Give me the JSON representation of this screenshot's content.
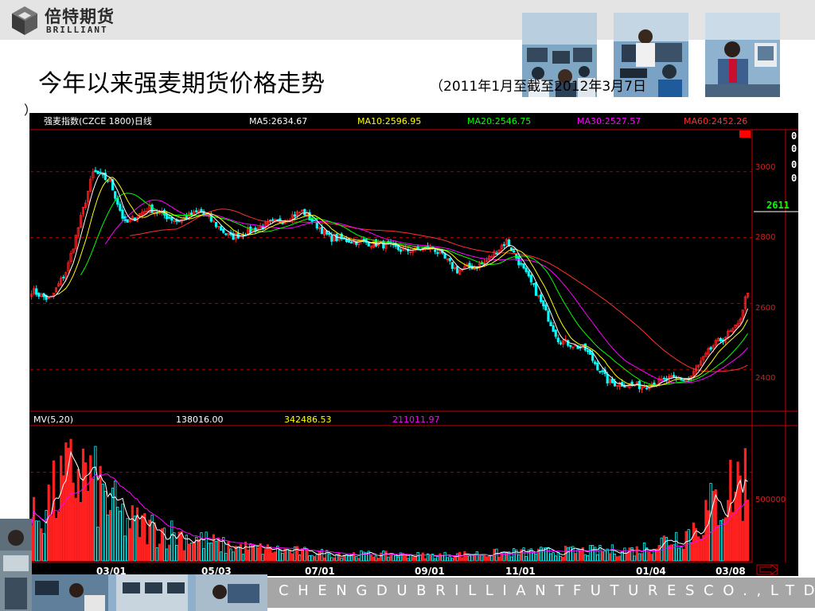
{
  "logo": {
    "name_cn": "倍特期货",
    "name_en": "BRILLIANT"
  },
  "title": "今年以来强麦期货价格走势",
  "subtitle": "（2011年1月至截至2012年3月7日",
  "subtitle_cont": "）",
  "footer": {
    "company": "CHENGDUBRILLIANTFUTURESCO.,LTD."
  },
  "colors": {
    "ma5": "#ffffff",
    "ma10": "#ffff00",
    "ma20": "#00ff00",
    "ma30": "#ff00ff",
    "ma60": "#ff3030",
    "up": "#ff2020",
    "down": "#00ffff",
    "axis": "#cc0000",
    "background": "#000000"
  },
  "chart_data": [
    {
      "type": "candlestick",
      "title": "强麦指数(CZCE 1800)日线",
      "legend": [
        {
          "key": "ma5",
          "label": "MA5:2634.67"
        },
        {
          "key": "ma10",
          "label": "MA10:2596.95"
        },
        {
          "key": "ma20",
          "label": "MA20:2546.75"
        },
        {
          "key": "ma30",
          "label": "MA30:2527.57"
        },
        {
          "key": "ma60",
          "label": "MA60:2452.26"
        }
      ],
      "y_ticks": [
        3000,
        2800,
        2600,
        2400
      ],
      "ylim": [
        2280,
        3120
      ],
      "x_ticks": [
        "03/01",
        "05/03",
        "07/01",
        "09/01",
        "11/01",
        "01/04",
        "03/08"
      ],
      "last_price": "2611",
      "right_digits": [
        "0",
        "0",
        "0",
        "0"
      ],
      "series": [
        {
          "name": "Close",
          "x": [
            "2011-01-04",
            "2011-01-15",
            "2011-01-25",
            "2011-02-10",
            "2011-02-20",
            "2011-03-01",
            "2011-03-15",
            "2011-04-01",
            "2011-04-15",
            "2011-05-03",
            "2011-05-20",
            "2011-06-01",
            "2011-06-15",
            "2011-07-01",
            "2011-07-15",
            "2011-08-01",
            "2011-08-15",
            "2011-09-01",
            "2011-09-15",
            "2011-10-01",
            "2011-10-15",
            "2011-11-01",
            "2011-11-15",
            "2011-12-01",
            "2011-12-15",
            "2012-01-04",
            "2012-01-20",
            "2012-02-01",
            "2012-02-15",
            "2012-03-01",
            "2012-03-07"
          ],
          "values": [
            2640,
            2610,
            2700,
            3000,
            2970,
            2840,
            2890,
            2850,
            2880,
            2800,
            2830,
            2850,
            2880,
            2800,
            2790,
            2780,
            2760,
            2770,
            2700,
            2720,
            2790,
            2640,
            2490,
            2460,
            2360,
            2350,
            2370,
            2370,
            2470,
            2530,
            2640
          ]
        }
      ]
    },
    {
      "type": "bar",
      "title": "MV(5,20)",
      "legend": [
        "138016.00",
        "342486.53",
        "211011.97"
      ],
      "y_ticks": [
        500000
      ],
      "ylim": [
        0,
        750000
      ],
      "series": [
        {
          "name": "Volume",
          "x": [
            "2011-01",
            "2011-02",
            "2011-03",
            "2011-05",
            "2011-07",
            "2011-09",
            "2011-11",
            "2012-01",
            "2012-02",
            "2012-03"
          ],
          "values": [
            180000,
            520000,
            220000,
            80000,
            40000,
            30000,
            50000,
            60000,
            160000,
            450000
          ]
        }
      ]
    }
  ]
}
